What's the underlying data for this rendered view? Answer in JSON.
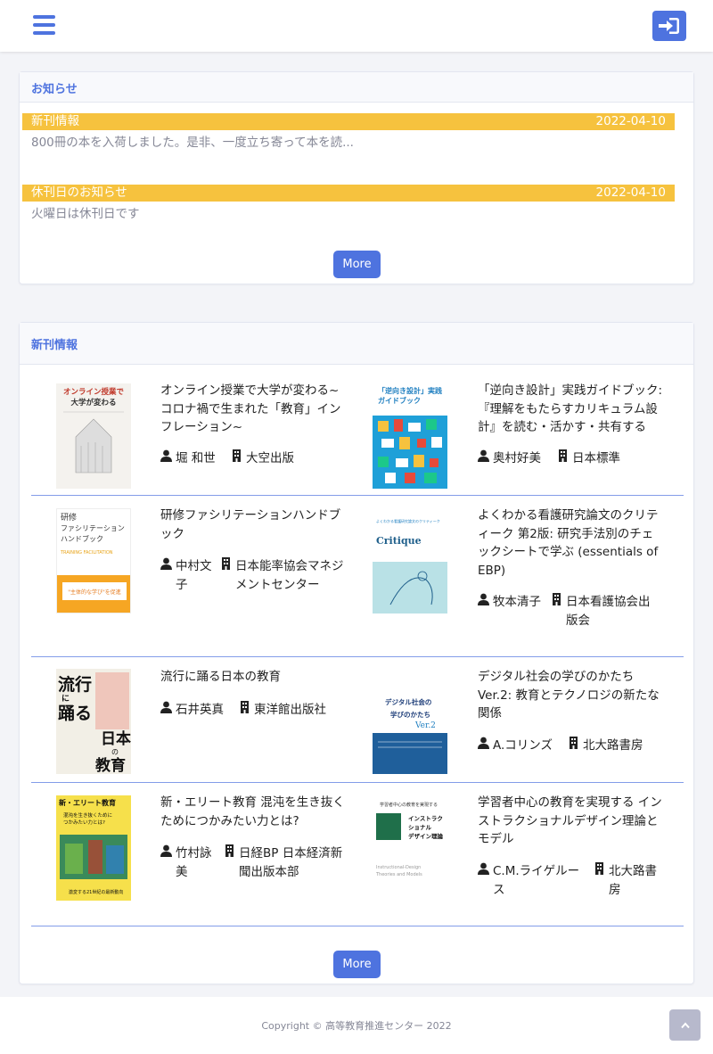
{
  "header": {
    "menu_icon": "hamburger-icon",
    "login_icon": "sign-in-icon",
    "accent": "#4e73df"
  },
  "notices": {
    "title": "お知らせ",
    "items": [
      {
        "category": "新刊情報",
        "date": "2022-04-10",
        "body": "800冊の本を入荷しました。是非、一度立ち寄って本を読..."
      },
      {
        "category": "休刊日のお知らせ",
        "date": "2022-04-10",
        "body": "火曜日は休刊日です"
      }
    ],
    "more_label": "More",
    "badge_color": "#f6c23e"
  },
  "new_books": {
    "title": "新刊情報",
    "books": [
      {
        "title": "オンライン授業で大学が変わる~コロナ禍で生まれた「教育」インフレーション~",
        "author": "堀 和世",
        "publisher": "大空出版",
        "cover": "オンライン授業で大学が変わる"
      },
      {
        "title": "「逆向き設計」実践ガイドブック: 『理解をもたらすカリキュラム設計』を読む・活かす・共有する",
        "author": "奥村好美",
        "publisher": "日本標準",
        "cover": "「逆向き設計」実践ガイドブック"
      },
      {
        "title": "研修ファシリテーションハンドブック",
        "author": "中村文子",
        "publisher": "日本能率協会マネジメントセンター",
        "cover": "研修ファシリテーションハンドブック"
      },
      {
        "title": "よくわかる看護研究論文のクリティーク 第2版: 研究手法別のチェックシートで学ぶ (essentials of EBP)",
        "author": "牧本清子",
        "publisher": "日本看護協会出版会",
        "cover": "Critique"
      },
      {
        "title": "流行に踊る日本の教育",
        "author": "石井英真",
        "publisher": "東洋館出版社",
        "cover": "流行に踊る日本の教育"
      },
      {
        "title": "デジタル社会の学びのかたち Ver.2: 教育とテクノロジの新たな関係",
        "author": "A.コリンズ",
        "publisher": "北大路書房",
        "cover": "デジタル社会の学びのかたち Ver.2"
      },
      {
        "title": "新・エリート教育 混沌を生き抜くためにつかみたい力とは?",
        "author": "竹村詠美",
        "publisher": "日経BP 日本経済新聞出版本部",
        "cover": "新・エリート教育"
      },
      {
        "title": "学習者中心の教育を実現する インストラクショナルデザイン理論とモデル",
        "author": "C.M.ライゲルース",
        "publisher": "北大路書房",
        "cover": "インストラクショナルデザイン理論とモデル"
      }
    ],
    "more_label": "More"
  },
  "footer": {
    "copyright": "Copyright © 高等教育推進センター 2022",
    "scroll_icon": "chevron-up-icon"
  }
}
